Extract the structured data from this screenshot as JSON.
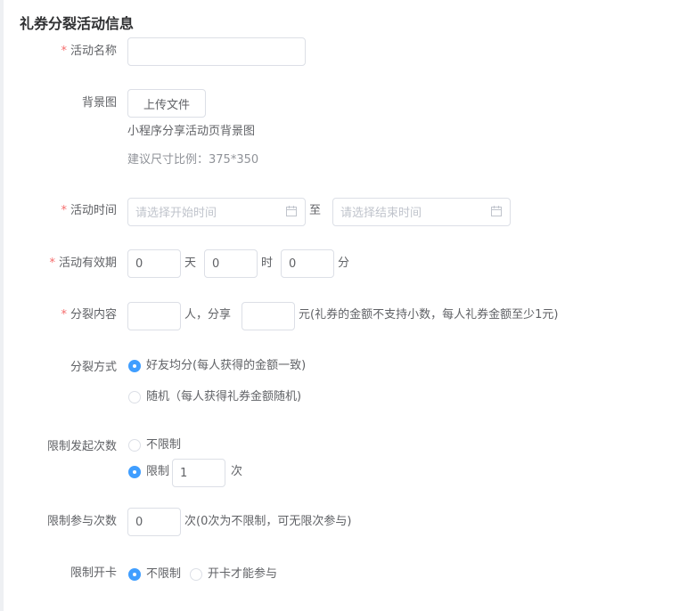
{
  "section_title": "礼券分裂活动信息",
  "colors": {
    "accent": "#409eff",
    "required": "#f56c6c",
    "border": "#dcdfe6",
    "placeholder": "#c0c4cc"
  },
  "activity_name": {
    "label": "活动名称",
    "required": "*",
    "value": ""
  },
  "background": {
    "label": "背景图",
    "upload_label": "上传文件",
    "desc": "小程序分享活动页背景图",
    "hint": "建议尺寸比例：375*350"
  },
  "activity_time": {
    "label": "活动时间",
    "required": "*",
    "start_placeholder": "请选择开始时间",
    "separator": "至",
    "end_placeholder": "请选择结束时间",
    "icon": "calendar-icon"
  },
  "validity": {
    "label": "活动有效期",
    "required": "*",
    "days_value": "0",
    "days_unit": "天",
    "hours_value": "0",
    "hours_unit": "时",
    "minutes_value": "0",
    "minutes_unit": "分"
  },
  "split_content": {
    "label": "分裂内容",
    "required": "*",
    "people_value": "",
    "people_text": "人，分享",
    "amount_value": "",
    "amount_text": "元(礼券的金额不支持小数，每人礼券金额至少1元)"
  },
  "split_method": {
    "label": "分裂方式",
    "options": [
      "好友均分(每人获得的金额一致)",
      "随机（每人获得礼券金额随机)"
    ],
    "selected": 0
  },
  "launch_limit": {
    "label": "限制发起次数",
    "unlimited_label": "不限制",
    "limited_label": "限制",
    "limit_value": "1",
    "unit": "次",
    "selected": "limited"
  },
  "join_limit": {
    "label": "限制参与次数",
    "value": "0",
    "hint": "次(0次为不限制，可无限次参与)"
  },
  "card_limit": {
    "label": "限制开卡",
    "options": [
      "不限制",
      "开卡才能参与"
    ],
    "selected": 0
  }
}
